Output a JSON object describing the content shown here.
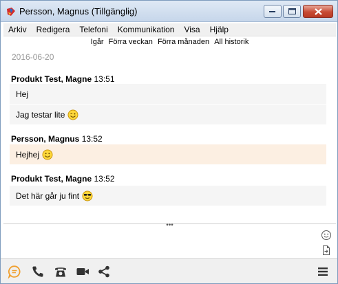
{
  "window": {
    "title": "Persson, Magnus (Tillgänglig)"
  },
  "menu": [
    "Arkiv",
    "Redigera",
    "Telefoni",
    "Kommunikation",
    "Visa",
    "Hjälp"
  ],
  "history_filters": [
    "Igår",
    "Förra veckan",
    "Förra månaden",
    "All historik"
  ],
  "conversation": {
    "date": "2016-06-20",
    "blocks": [
      {
        "sender": "Produkt Test, Magne",
        "time": "13:51",
        "messages": [
          "Hej",
          "Jag testar lite"
        ]
      },
      {
        "sender": "Persson, Magnus",
        "time": "13:52",
        "messages": [
          "Hejhej"
        ]
      },
      {
        "sender": "Produkt Test, Magne",
        "time": "13:52",
        "messages": [
          "Det här går ju fint"
        ]
      }
    ]
  },
  "splitter_label": "•••",
  "icons": {
    "app": "app-icon",
    "emoji_picker": "smiley-icon",
    "attach": "file-icon",
    "chat": "chat-icon",
    "phone": "phone-icon",
    "desk_phone": "desk-phone-icon",
    "video": "video-icon",
    "share": "share-icon",
    "menu": "hamburger-icon"
  },
  "colors": {
    "accent": "#f0a030",
    "own_message_bg": "#fcefe2",
    "other_message_bg": "#f5f5f5",
    "date_text": "#999999"
  }
}
